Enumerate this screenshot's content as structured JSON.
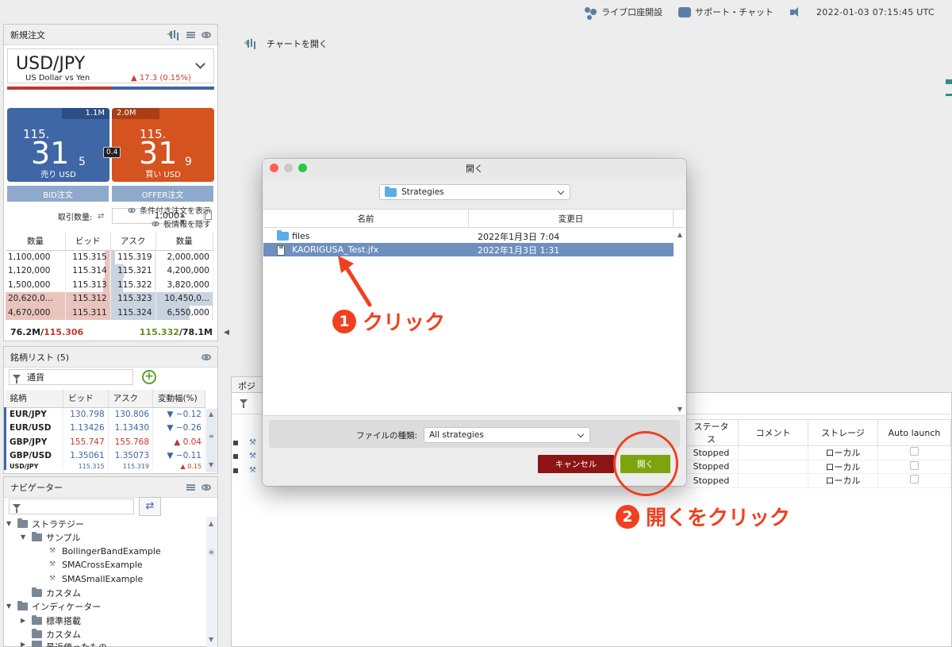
{
  "topbar": {
    "live_account": "ライブ口座開設",
    "support_chat": "サポート・チャット",
    "datetime": "2022-01-03 07:15:45 UTC"
  },
  "new_order": {
    "title": "新規注文",
    "symbol": "USD/JPY",
    "description": "US Dollar vs Yen",
    "change": "17.3 (0.15%)",
    "sell": {
      "volume": "1.1M",
      "prefix": "115.",
      "big": "31",
      "small": "5",
      "label": "売り USD"
    },
    "buy": {
      "volume": "2.0M",
      "prefix": "115.",
      "big": "31",
      "small": "9",
      "label": "買い USD"
    },
    "spread": "0.4",
    "bid_button": "BID注文",
    "offer_button": "OFFER注文",
    "quantity_label": "取引数量:",
    "quantity_value": "1,000",
    "show_conditional": "条件付き注文を表示",
    "hide_book": "板情報を隠す",
    "book_headers": [
      "数量",
      "ビッド",
      "アスク",
      "数量"
    ],
    "book_rows": [
      [
        "1,100,000",
        "115.315",
        "115.319",
        "2,000,000"
      ],
      [
        "1,120,000",
        "115.314",
        "115.321",
        "4,200,000"
      ],
      [
        "1,500,000",
        "115.313",
        "115.322",
        "3,820,000"
      ],
      [
        "20,620,0...",
        "115.312",
        "115.323",
        "10,450,0..."
      ],
      [
        "4,670,000",
        "115.311",
        "115.324",
        "6,550,000"
      ]
    ],
    "footer_bid_vol": "76.2M/",
    "footer_bid_avg": "115.306",
    "footer_ask_avg": "115.332",
    "footer_ask_vol": "/78.1M"
  },
  "watchlist": {
    "title": "銘柄リスト (5)",
    "filter_value": "通貨",
    "headers": [
      "銘柄",
      "ビッド",
      "アスク",
      "変動幅(%)"
    ],
    "rows": [
      {
        "sym": "EUR/JPY",
        "bid": "130.798",
        "ask": "130.806",
        "chg": "−0.12",
        "dir": "dn"
      },
      {
        "sym": "EUR/USD",
        "bid": "1.13426",
        "ask": "1.13430",
        "chg": "−0.26",
        "dir": "dn"
      },
      {
        "sym": "GBP/JPY",
        "bid": "155.747",
        "ask": "155.768",
        "chg": "0.04",
        "dir": "up"
      },
      {
        "sym": "GBP/USD",
        "bid": "1.35061",
        "ask": "1.35073",
        "chg": "−0.11",
        "dir": "dn"
      },
      {
        "sym": "USD/JPY",
        "bid": "115.315",
        "ask": "115.319",
        "chg": "0.15",
        "dir": "up"
      }
    ]
  },
  "navigator": {
    "title": "ナビゲーター",
    "items": {
      "strategies": "ストラテジー",
      "samples": "サンプル",
      "s1": "BollingerBandExample",
      "s2": "SMACrossExample",
      "s3": "SMASmallExample",
      "custom": "カスタム",
      "indicators": "インディケーター",
      "standard": "標準搭載",
      "custom2": "カスタム",
      "recent": "最近使ったもの"
    }
  },
  "main": {
    "open_chart": "チャートを開く",
    "tab_label": "ポジシ",
    "strategy_headers": [
      "ステータス",
      "コメント",
      "ストレージ",
      "Auto launch"
    ],
    "strategy_rows": [
      [
        "Stopped",
        "",
        "ローカル"
      ],
      [
        "Stopped",
        "",
        "ローカル"
      ],
      [
        "Stopped",
        "",
        "ローカル"
      ]
    ]
  },
  "dialog": {
    "title": "開く",
    "folder": "Strategies",
    "col_name": "名前",
    "col_modified": "変更日",
    "files": [
      {
        "name": "files",
        "date": "2022年1月3日 7:04"
      },
      {
        "name": "KAORIGUSA_Test.jfx",
        "date": "2022年1月3日 1:31"
      }
    ],
    "filetype_label": "ファイルの種類:",
    "filetype_value": "All strategies",
    "cancel": "キャンセル",
    "open": "開く"
  },
  "annotations": {
    "step1_num": "1",
    "step1_text": "クリック",
    "step2_num": "2",
    "step2_text": "開くをクリック"
  },
  "colors": {
    "sell": "#3f66a5",
    "buy": "#d4531f",
    "annotation": "#f04020",
    "open_button": "#7da40e",
    "cancel_button": "#8c1414"
  }
}
